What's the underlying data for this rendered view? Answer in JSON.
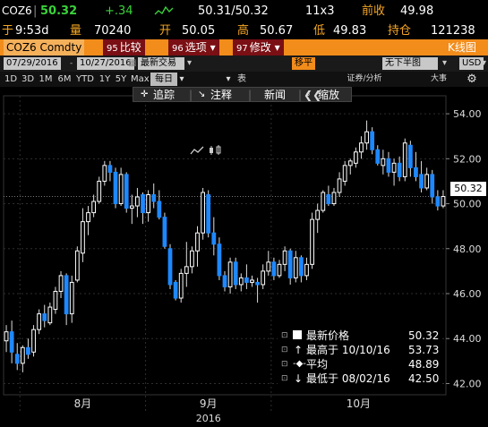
{
  "quote": {
    "ticker": "COZ6",
    "last": "50.32",
    "change": "+.34",
    "bid_ask": "50.31/50.32",
    "size": "11x3",
    "prev_label": "前收",
    "prev_value": "49.98",
    "time_label": "于",
    "time": "9:53d",
    "vol_label": "量",
    "volume": "70240",
    "open_label": "开",
    "open": "50.05",
    "high_label": "高",
    "high": "50.67",
    "low_label": "低",
    "low": "49.83",
    "oi_label": "持仓",
    "oi": "121238"
  },
  "menubar": {
    "security": "COZ6 Comdty",
    "compare_num": "95",
    "compare": "比较",
    "options_num": "96",
    "options": "选项",
    "edit_num": "97",
    "edit": "修改",
    "chart_type": "K线图"
  },
  "controls": {
    "start_date": "07/29/2016",
    "end_date": "10/27/2016",
    "last_trade": "最新交易",
    "smooth": "移平",
    "no_stack": "无下半图",
    "currency": "USD"
  },
  "ranges": [
    "1D",
    "3D",
    "1M",
    "6M",
    "YTD",
    "1Y",
    "5Y",
    "Max"
  ],
  "period": "每日",
  "misc": {
    "table": "表",
    "securities": "证券/分析",
    "events": "大事"
  },
  "toolbar": {
    "track": "追踪",
    "annotate": "注释",
    "news": "新闻",
    "zoom": "缩放"
  },
  "legend": {
    "last_label": "最新价格",
    "last_value": "50.32",
    "high_label": "最高于 10/10/16",
    "high_value": "53.73",
    "avg_label": "平均",
    "avg_value": "48.89",
    "low_label": "最低于 08/02/16",
    "low_value": "42.50"
  },
  "price_tag": "50.32",
  "colors": {
    "up": "#ffffff",
    "down": "#1e88ff",
    "accent": "#f28c1b",
    "positive": "#3ad23a"
  },
  "chart_data": {
    "type": "candlestick",
    "ylim": [
      41.5,
      54.8
    ],
    "yticks": [
      "54.00",
      "52.00",
      "50.00",
      "48.00",
      "46.00",
      "44.00",
      "42.00"
    ],
    "ytick_values": [
      54,
      52,
      50,
      48,
      46,
      44,
      42
    ],
    "x_month_labels": [
      "8月",
      "9月",
      "10月"
    ],
    "x_year_label": "2016",
    "month_start_index": [
      0,
      3,
      26,
      49
    ],
    "candles": [
      [
        43.9,
        44.6,
        43.4,
        44.3
      ],
      [
        44.3,
        44.8,
        42.9,
        43.4
      ],
      [
        43.3,
        43.8,
        42.6,
        42.9
      ],
      [
        42.9,
        43.7,
        42.5,
        43.6
      ],
      [
        43.6,
        44.0,
        43.1,
        43.3
      ],
      [
        43.4,
        44.6,
        43.2,
        44.4
      ],
      [
        44.4,
        45.3,
        44.2,
        45.1
      ],
      [
        45.1,
        45.5,
        44.5,
        44.8
      ],
      [
        44.7,
        45.6,
        44.6,
        45.4
      ],
      [
        45.3,
        46.3,
        45.1,
        46.1
      ],
      [
        46.1,
        47.0,
        45.8,
        46.8
      ],
      [
        46.8,
        46.9,
        44.6,
        45.1
      ],
      [
        45.1,
        46.8,
        44.7,
        46.5
      ],
      [
        46.6,
        48.1,
        46.5,
        47.9
      ],
      [
        47.8,
        49.8,
        47.4,
        49.2
      ],
      [
        49.2,
        49.9,
        48.6,
        49.6
      ],
      [
        49.6,
        50.4,
        49.4,
        50.1
      ],
      [
        50.1,
        51.2,
        50.0,
        51.0
      ],
      [
        51.0,
        51.9,
        50.8,
        51.7
      ],
      [
        51.7,
        51.9,
        51.0,
        51.4
      ],
      [
        51.4,
        51.6,
        49.8,
        50.0
      ],
      [
        50.0,
        51.6,
        49.9,
        51.3
      ],
      [
        51.3,
        51.4,
        49.6,
        49.8
      ],
      [
        49.8,
        50.4,
        49.1,
        49.9
      ],
      [
        49.9,
        50.7,
        49.4,
        50.3
      ],
      [
        50.4,
        50.5,
        49.1,
        49.6
      ],
      [
        49.6,
        50.6,
        49.2,
        50.4
      ],
      [
        50.4,
        50.9,
        49.8,
        50.1
      ],
      [
        50.1,
        50.6,
        49.3,
        49.4
      ],
      [
        49.4,
        49.6,
        48.0,
        48.1
      ],
      [
        48.0,
        48.2,
        46.2,
        46.4
      ],
      [
        46.5,
        46.6,
        45.7,
        45.8
      ],
      [
        45.8,
        47.1,
        45.6,
        46.9
      ],
      [
        46.9,
        48.3,
        46.3,
        47.2
      ],
      [
        47.2,
        48.1,
        46.9,
        47.9
      ],
      [
        47.9,
        49.0,
        47.2,
        48.7
      ],
      [
        48.7,
        50.7,
        48.4,
        50.5
      ],
      [
        50.4,
        50.6,
        48.5,
        48.7
      ],
      [
        48.7,
        49.4,
        47.7,
        48.2
      ],
      [
        48.2,
        48.5,
        46.6,
        46.8
      ],
      [
        46.8,
        47.0,
        46.1,
        46.3
      ],
      [
        46.3,
        47.6,
        46.0,
        47.4
      ],
      [
        47.4,
        47.6,
        46.2,
        46.4
      ],
      [
        46.4,
        46.9,
        46.1,
        46.7
      ],
      [
        46.7,
        47.3,
        46.2,
        46.5
      ],
      [
        46.5,
        46.8,
        46.3,
        46.6
      ],
      [
        46.5,
        46.7,
        45.6,
        46.4
      ],
      [
        46.4,
        47.3,
        46.2,
        47.0
      ],
      [
        47.0,
        47.9,
        46.8,
        47.4
      ],
      [
        47.4,
        47.6,
        46.6,
        46.8
      ],
      [
        46.8,
        47.5,
        46.7,
        47.3
      ],
      [
        47.3,
        48.1,
        47.0,
        47.9
      ],
      [
        47.9,
        48.0,
        46.4,
        46.7
      ],
      [
        46.7,
        47.9,
        46.5,
        47.6
      ],
      [
        47.6,
        47.7,
        46.5,
        46.8
      ],
      [
        46.8,
        47.6,
        46.6,
        47.3
      ],
      [
        47.3,
        49.6,
        47.1,
        49.3
      ],
      [
        49.3,
        50.0,
        48.7,
        49.7
      ],
      [
        49.7,
        50.6,
        49.6,
        50.5
      ],
      [
        50.4,
        50.8,
        49.9,
        50.0
      ],
      [
        50.0,
        50.7,
        49.9,
        50.5
      ],
      [
        50.5,
        51.4,
        50.3,
        51.1
      ],
      [
        51.0,
        51.9,
        50.8,
        51.7
      ],
      [
        51.7,
        52.0,
        51.3,
        51.9
      ],
      [
        51.8,
        52.5,
        51.6,
        52.3
      ],
      [
        52.3,
        53.0,
        52.0,
        52.7
      ],
      [
        52.7,
        53.7,
        52.4,
        53.2
      ],
      [
        53.2,
        53.4,
        52.2,
        52.4
      ],
      [
        52.4,
        52.6,
        51.7,
        51.8
      ],
      [
        51.7,
        52.4,
        51.3,
        52.0
      ],
      [
        52.0,
        52.3,
        51.2,
        51.4
      ],
      [
        51.4,
        52.0,
        50.8,
        51.8
      ],
      [
        51.8,
        52.1,
        51.0,
        51.2
      ],
      [
        51.2,
        52.9,
        51.0,
        52.7
      ],
      [
        52.6,
        52.8,
        51.2,
        51.6
      ],
      [
        51.6,
        52.3,
        51.0,
        51.2
      ],
      [
        51.3,
        51.9,
        50.5,
        50.7
      ],
      [
        50.7,
        51.6,
        50.6,
        51.3
      ],
      [
        51.3,
        51.5,
        50.0,
        50.3
      ],
      [
        50.3,
        50.6,
        49.7,
        49.9
      ],
      [
        49.9,
        50.6,
        49.8,
        50.32
      ]
    ]
  }
}
